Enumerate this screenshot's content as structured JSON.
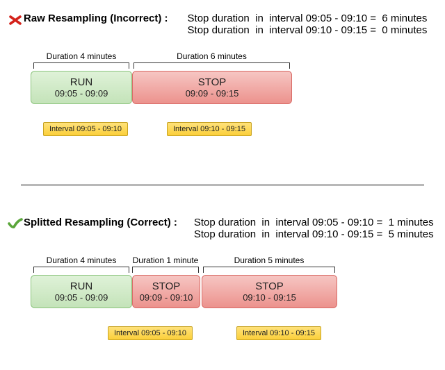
{
  "chart_data": {
    "type": "table",
    "methods": [
      {
        "name": "Raw Resampling",
        "correctness": "Incorrect",
        "computed": [
          {
            "interval": "09:05 - 09:10",
            "stop_duration_minutes": 6
          },
          {
            "interval": "09:10 - 09:15",
            "stop_duration_minutes": 0
          }
        ]
      },
      {
        "name": "Splitted Resampling",
        "correctness": "Correct",
        "computed": [
          {
            "interval": "09:05 - 09:10",
            "stop_duration_minutes": 1
          },
          {
            "interval": "09:10 - 09:15",
            "stop_duration_minutes": 5
          }
        ]
      }
    ],
    "intervals": [
      "09:05 - 09:10",
      "09:10 - 09:15"
    ],
    "raw_events": [
      {
        "state": "RUN",
        "start": "09:05",
        "end": "09:09",
        "duration_minutes": 4
      },
      {
        "state": "STOP",
        "start": "09:09",
        "end": "09:15",
        "duration_minutes": 6
      }
    ],
    "split_events": [
      {
        "state": "RUN",
        "start": "09:05",
        "end": "09:09",
        "duration_minutes": 4
      },
      {
        "state": "STOP",
        "start": "09:09",
        "end": "09:10",
        "duration_minutes": 1
      },
      {
        "state": "STOP",
        "start": "09:10",
        "end": "09:15",
        "duration_minutes": 5
      }
    ]
  },
  "icons": {
    "incorrect": "cross-icon",
    "correct": "check-icon"
  },
  "section_raw": {
    "title": "Raw Resampling (Incorrect) :",
    "result1": "Stop duration  in  interval 09:05 - 09:10 =  6 minutes",
    "result2": "Stop duration  in  interval 09:10 - 09:15 =  0 minutes",
    "dur1": "Duration 4 minutes",
    "dur2": "Duration 6 minutes",
    "block1_name": "RUN",
    "block1_time": "09:05 - 09:09",
    "block2_name": "STOP",
    "block2_time": "09:09 - 09:15",
    "interval1": "Interval 09:05 - 09:10",
    "interval2": "Interval 09:10 - 09:15"
  },
  "section_split": {
    "title": "Splitted Resampling (Correct) :",
    "result1": "Stop duration  in  interval 09:05 - 09:10 =  1 minutes",
    "result2": "Stop duration  in  interval 09:10 - 09:15 =  5 minutes",
    "dur1": "Duration 4 minutes",
    "dur2": "Duration 1 minute",
    "dur3": "Duration 5 minutes",
    "block1_name": "RUN",
    "block1_time": "09:05 - 09:09",
    "block2_name": "STOP",
    "block2_time": "09:09 - 09:10",
    "block3_name": "STOP",
    "block3_time": "09:10 - 09:15",
    "interval1": "Interval 09:05 - 09:10",
    "interval2": "Interval 09:10 - 09:15"
  }
}
